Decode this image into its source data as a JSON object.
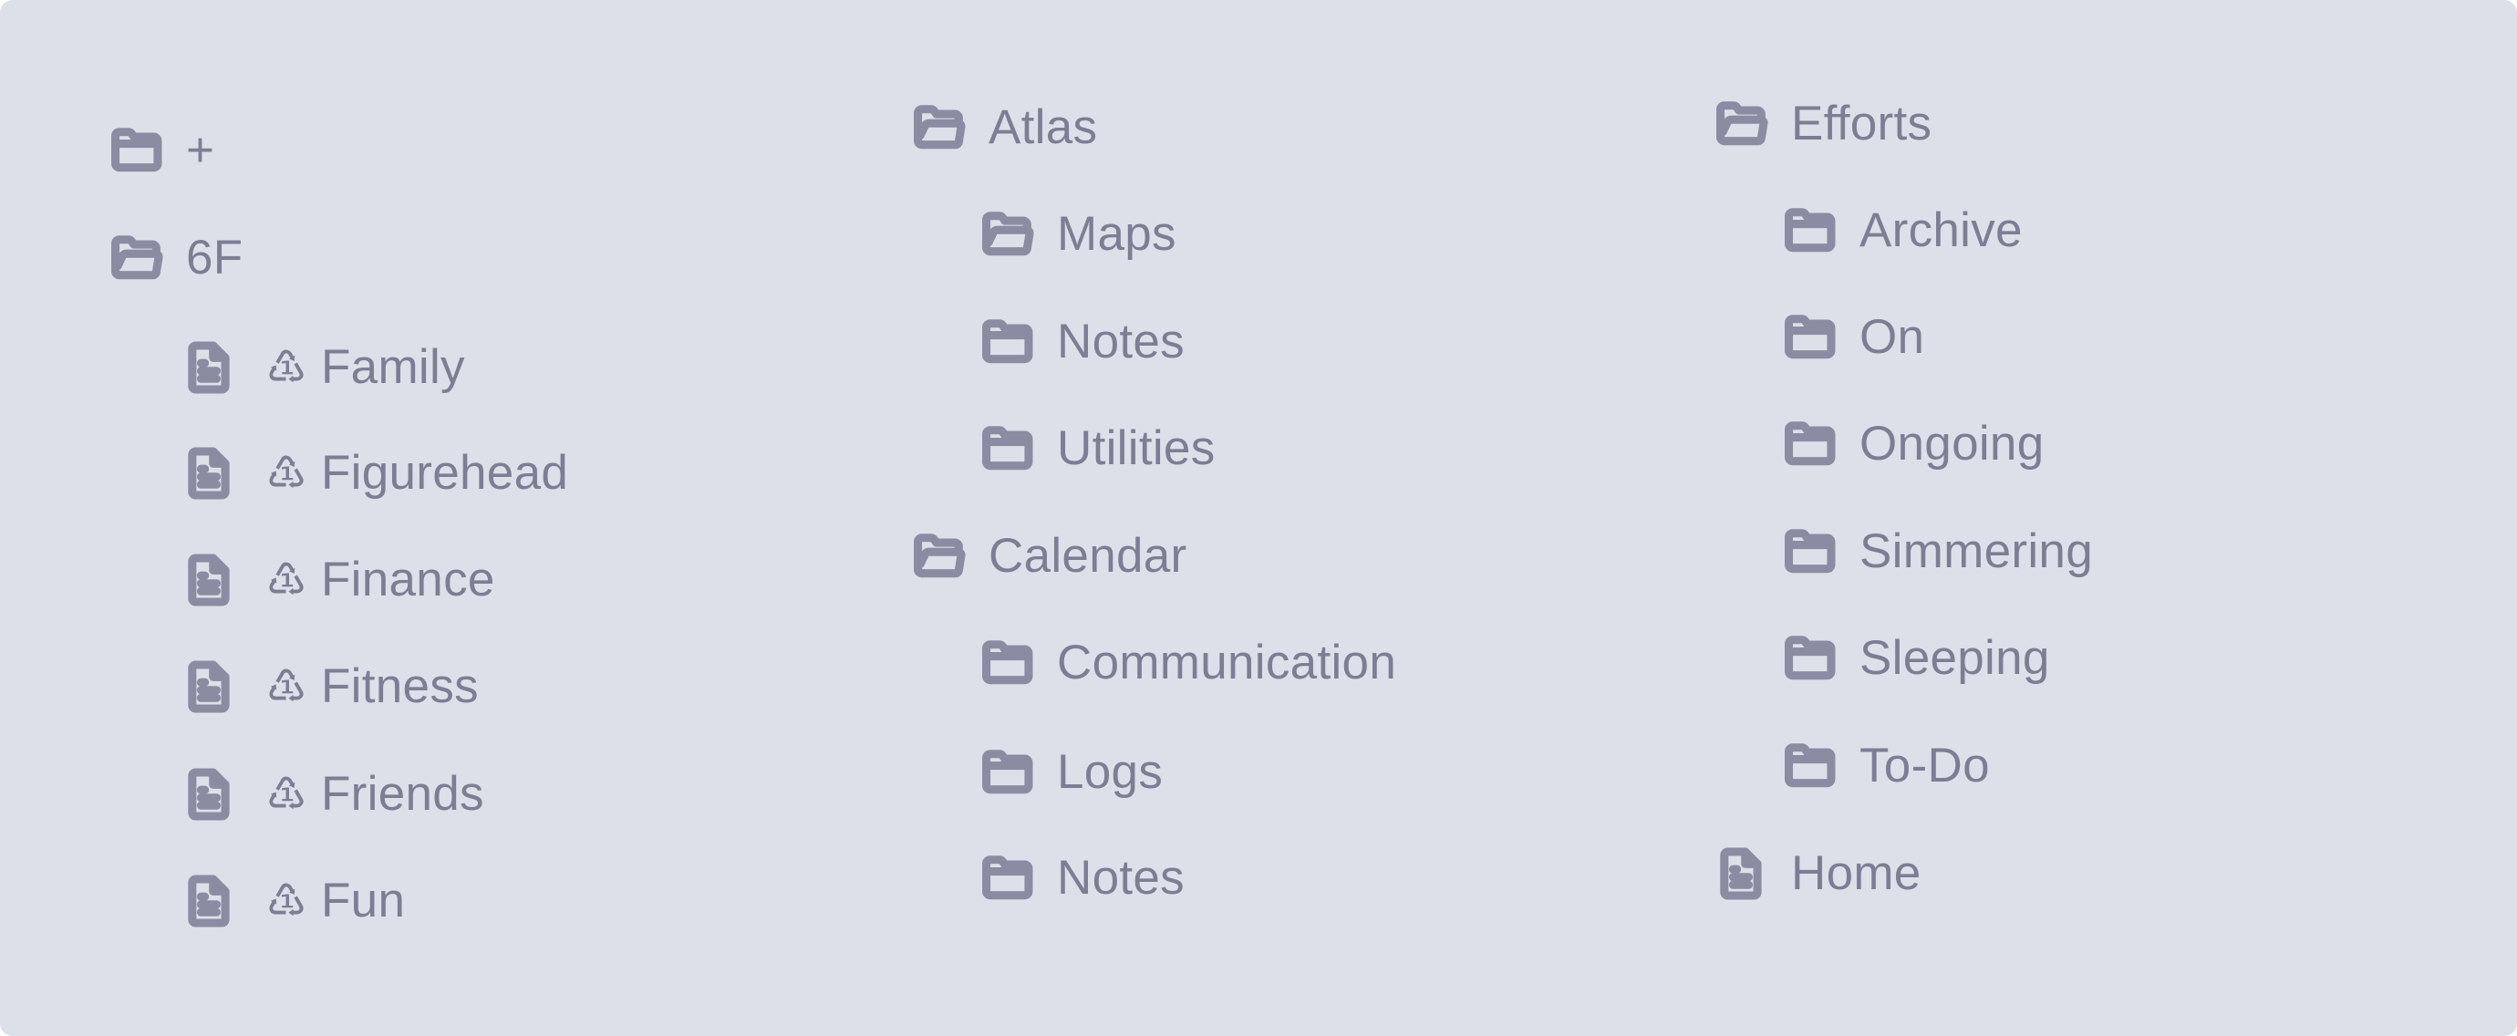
{
  "colors": {
    "background": "#dce0e8",
    "text": "#7c7f93",
    "icon": "#8a8da2"
  },
  "columns": [
    {
      "items": [
        {
          "label": "+",
          "icon": "folder-closed-icon",
          "level": 0
        },
        {
          "label": "6F",
          "icon": "folder-open-icon",
          "level": 0
        },
        {
          "label": "Family",
          "icon": "document-icon",
          "badge": "♳",
          "badge_icon": "recycle-1-icon",
          "level": 1
        },
        {
          "label": "Figurehead",
          "icon": "document-icon",
          "badge": "♳",
          "badge_icon": "recycle-1-icon",
          "level": 1
        },
        {
          "label": "Finance",
          "icon": "document-icon",
          "badge": "♳",
          "badge_icon": "recycle-1-icon",
          "level": 1
        },
        {
          "label": "Fitness",
          "icon": "document-icon",
          "badge": "♳",
          "badge_icon": "recycle-1-icon",
          "level": 1
        },
        {
          "label": "Friends",
          "icon": "document-icon",
          "badge": "♳",
          "badge_icon": "recycle-1-icon",
          "level": 1
        },
        {
          "label": "Fun",
          "icon": "document-icon",
          "badge": "♳",
          "badge_icon": "recycle-1-icon",
          "level": 1
        }
      ]
    },
    {
      "items": [
        {
          "label": "Atlas",
          "icon": "folder-open-icon",
          "level": 0
        },
        {
          "label": "Maps",
          "icon": "folder-open-icon",
          "level": 1
        },
        {
          "label": "Notes",
          "icon": "folder-closed-icon",
          "level": 1
        },
        {
          "label": "Utilities",
          "icon": "folder-closed-icon",
          "level": 1
        },
        {
          "label": "Calendar",
          "icon": "folder-open-icon",
          "level": 0
        },
        {
          "label": "Communication",
          "icon": "folder-closed-icon",
          "level": 1
        },
        {
          "label": "Logs",
          "icon": "folder-closed-icon",
          "level": 1
        },
        {
          "label": "Notes",
          "icon": "folder-closed-icon",
          "level": 1
        }
      ]
    },
    {
      "items": [
        {
          "label": "Efforts",
          "icon": "folder-open-icon",
          "level": 0
        },
        {
          "label": "Archive",
          "icon": "folder-closed-icon",
          "level": 1
        },
        {
          "label": "On",
          "icon": "folder-closed-icon",
          "level": 1
        },
        {
          "label": "Ongoing",
          "icon": "folder-closed-icon",
          "level": 1
        },
        {
          "label": "Simmering",
          "icon": "folder-closed-icon",
          "level": 1
        },
        {
          "label": "Sleeping",
          "icon": "folder-closed-icon",
          "level": 1
        },
        {
          "label": "To-Do",
          "icon": "folder-closed-icon",
          "level": 1
        },
        {
          "label": "Home",
          "icon": "document-icon",
          "level": 0
        }
      ]
    }
  ]
}
